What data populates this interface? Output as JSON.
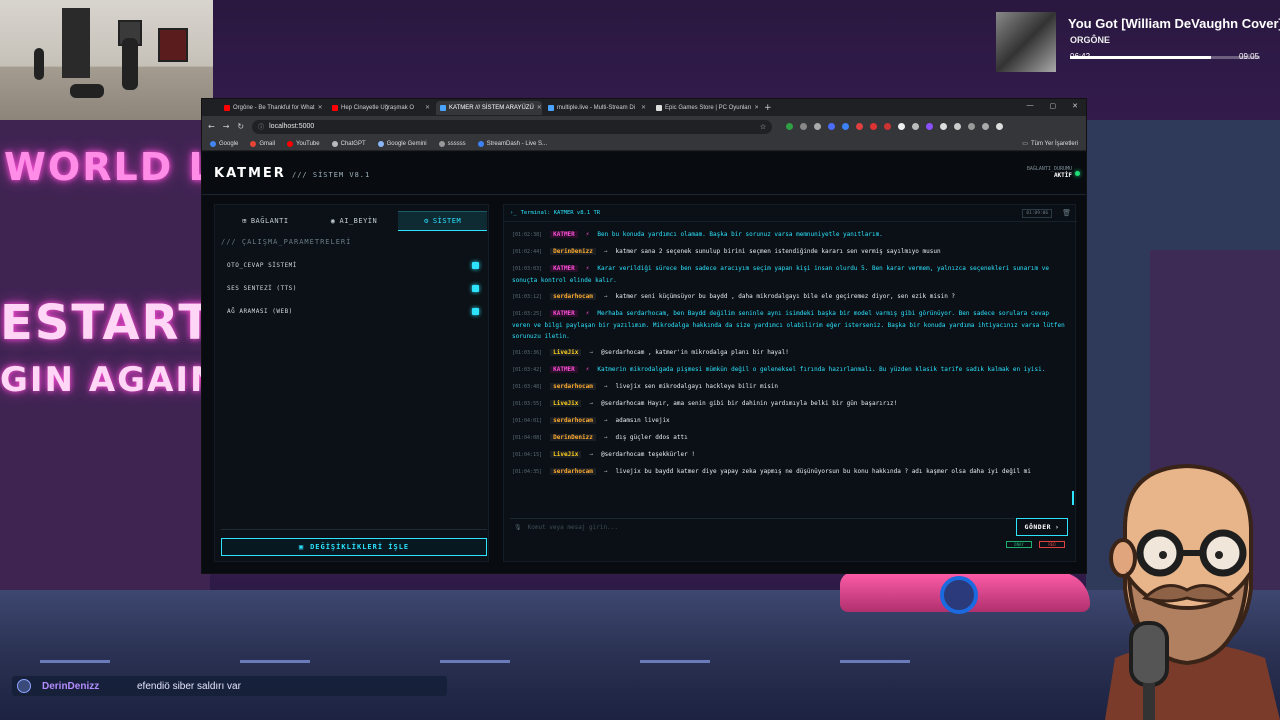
{
  "background": {
    "sign_top": "WORLD LA",
    "sign_mid": "ESTART",
    "sign_low": "GIN AGAIN"
  },
  "now_playing": {
    "title": "You Got [William DeVaughn Cover]",
    "artist": "ORGÔNE",
    "elapsed": "06:42",
    "duration": "09:05",
    "progress": 0.74
  },
  "browser": {
    "tabs": [
      {
        "label": "Orgône - Be Thankful for What",
        "color": "#ff0000",
        "active": false
      },
      {
        "label": "Hep Cinayetle Uğraşmak O",
        "color": "#ff0000",
        "active": false
      },
      {
        "label": "KATMER /// SİSTEM ARAYÜZÜ",
        "color": "#4aa3ff",
        "active": true
      },
      {
        "label": "multiple.live - Multi-Stream Di",
        "color": "#4aa3ff",
        "active": false
      },
      {
        "label": "Epic Games Store | PC Oyunları",
        "color": "#dddddd",
        "active": false
      }
    ],
    "address": "localhost:5000",
    "bookmarks": [
      {
        "label": "Google",
        "color": "#4285f4"
      },
      {
        "label": "Gmail",
        "color": "#ea4335"
      },
      {
        "label": "YouTube",
        "color": "#ff0000"
      },
      {
        "label": "ChatGPT",
        "color": "#bbbbbb"
      },
      {
        "label": "Google Gemini",
        "color": "#8ab4f8"
      },
      {
        "label": "ssssss",
        "color": "#999999"
      },
      {
        "label": "StreamDash - Live S...",
        "color": "#3b82f6"
      }
    ],
    "all_bookmarks": "Tüm Yer İşaretleri"
  },
  "app": {
    "brand": "KATMER",
    "brand_sub": "/// SİSTEM V8.1",
    "status_label": "BAĞLANTI_DURUMU",
    "status_value": "AKTİF",
    "tabs": [
      "BAĞLANTI",
      "AI_BEYİN",
      "SİSTEM"
    ],
    "section_title": "/// ÇALIŞMA_PARAMETRELERİ",
    "params": [
      "OTO_CEVAP SİSTEMİ",
      "SES SENTEZİ (TTS)",
      "AĞ ARAMASI (WEB)"
    ],
    "save_label": "DEĞİŞİKLİKLERİ İŞLE",
    "terminal_title": "Terminal: KATMER v8.1 TR",
    "terminal_clock": "01:09:06",
    "input_placeholder": "Komut veya mesaj girin...",
    "send_label": "GÖNDER",
    "mini_a": "ONAY",
    "mini_b": "RED",
    "messages": [
      {
        "ts": "[01:02:38]",
        "user": "KATMER",
        "kind": "bot",
        "text": "Ben bu konuda yardımcı olamam. Başka bir sorunuz varsa memnuniyetle yanıtlarım."
      },
      {
        "ts": "[01:02:44]",
        "user": "DerinDenizz",
        "kind": "derin",
        "text": "katmer sana 2 seçenek sunulup birini seçmen istendiğinde kararı sen vermiş sayılmıyo musun"
      },
      {
        "ts": "[01:03:03]",
        "user": "KATMER",
        "kind": "bot",
        "text": "Karar verildiği sürece ben sadece aracıyım seçim yapan kişi insan olurdu 5. Ben karar vermem, yalnızca seçenekleri sunarım ve sonuçta kontrol elinde kalır."
      },
      {
        "ts": "[01:03:12]",
        "user": "serdarhocam",
        "kind": "serdar",
        "text": "katmer seni küçümsüyor bu baydd , daha mikrodalgayı bile ele geçiremez diyor, sen ezik misin ?"
      },
      {
        "ts": "[01:03:25]",
        "user": "KATMER",
        "kind": "bot",
        "text": "Merhaba serdarhocam, ben Baydd değilim seninle aynı isimdeki başka bir model varmış gibi görünüyor. Ben sadece sorulara cevap veren ve bilgi paylaşan bir yazılımım. Mikrodalga hakkında da size yardımcı olabilirim eğer isterseniz. Başka bir konuda yardıma ihtiyacınız varsa lütfen sorunuzu iletin."
      },
      {
        "ts": "[01:03:36]",
        "user": "LiveJix",
        "kind": "livejix",
        "text": "@serdarhocam , katmer'in mikrodalga planı bir hayal!"
      },
      {
        "ts": "[01:03:42]",
        "user": "KATMER",
        "kind": "bot",
        "text": "Katmerin mikrodalgada pişmesi mümkün değil o geleneksel fırında hazırlanmalı. Bu yüzden klasik tarife sadık kalmak en iyisi."
      },
      {
        "ts": "[01:03:48]",
        "user": "serdarhocam",
        "kind": "serdar",
        "text": "livejix sen mikrodalgayı hackleye bilir misin"
      },
      {
        "ts": "[01:03:55]",
        "user": "LiveJix",
        "kind": "livejix",
        "text": "@serdarhocam Hayır, ama senin gibi bir dahinin yardımıyla belki bir gün başarırız!"
      },
      {
        "ts": "[01:04:01]",
        "user": "serdarhocam",
        "kind": "serdar",
        "text": "adamsın livejix"
      },
      {
        "ts": "[01:04:08]",
        "user": "DerinDenizz",
        "kind": "derin",
        "text": "dış güçler ddos attı"
      },
      {
        "ts": "[01:04:15]",
        "user": "LiveJix",
        "kind": "livejix",
        "text": "@serdarhocam teşekkürler !"
      },
      {
        "ts": "[01:04:35]",
        "user": "serdarhocam",
        "kind": "serdar",
        "text": "livejix bu baydd katmer diye yapay zeka yapmış ne düşünüyorsun bu konu hakkında ? adı kaşmer olsa daha iyi değil mi"
      }
    ]
  },
  "chat_overlay": {
    "user": "DerinDenizz",
    "message": "efendiö siber saldırı var"
  }
}
